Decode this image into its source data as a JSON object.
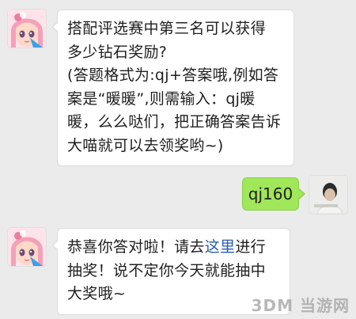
{
  "messages": [
    {
      "sender": "bot",
      "lines": [
        "搭配评选赛中第三名可以获得",
        "多少钻石奖励?",
        "(答题格式为:qj+答案哦,例如答",
        "案是“暖暖”,则需输入：qj暖",
        "暖，么么哒们，把正确答案告诉",
        "大喵就可以去领奖哟~)"
      ]
    },
    {
      "sender": "user",
      "text": "qj160"
    },
    {
      "sender": "bot",
      "line1_before": "恭喜你答对啦！请去",
      "line1_link": "这里",
      "line1_after": "进行",
      "line2": "抽奖！说不定你今天就能抽中",
      "line3": "大奖哦~"
    }
  ],
  "watermark": "3DM 当游网",
  "colors": {
    "background": "#ebebeb",
    "bot_bubble": "#ffffff",
    "user_bubble": "#a0e759",
    "link": "#2a5db0"
  },
  "icons": {
    "bot_avatar": "anime-girl-avatar",
    "user_avatar": "user-photo-avatar"
  }
}
